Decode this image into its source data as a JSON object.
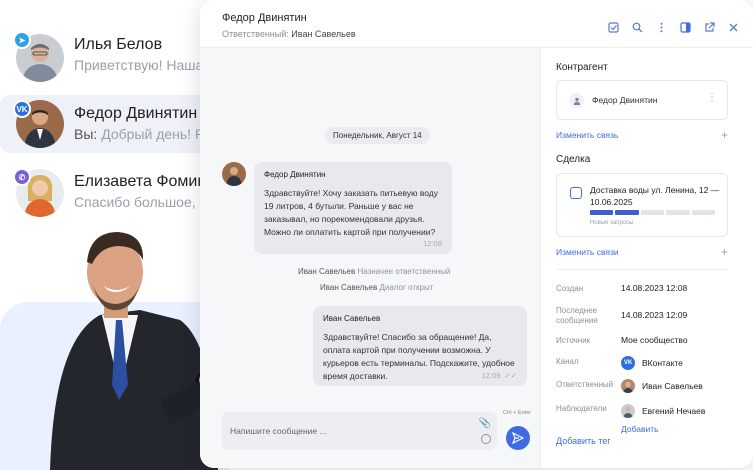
{
  "chat_list": [
    {
      "name": "Илья Белов",
      "you": "",
      "preview": "Приветствую! Наша",
      "channel": "telegram",
      "channel_color": "#2fa3e0",
      "badge_glyph": "➤"
    },
    {
      "name": "Федор Двинятин",
      "you": "Вы:",
      "preview": "Добрый день! Р",
      "channel": "vk",
      "channel_color": "#2e6fe0",
      "badge_glyph": "VK"
    },
    {
      "name": "Елизавета Фомин",
      "you": "",
      "preview": "Спасибо большое, п",
      "channel": "viber",
      "channel_color": "#7b5fd6",
      "badge_glyph": "✆"
    }
  ],
  "header": {
    "title": "Федор Двинятин",
    "subtitle_label": "Ответственный:",
    "subtitle_value": "Иван Савельев",
    "icons": [
      "checkbox-icon",
      "search-icon",
      "more-vertical-icon",
      "panel-icon",
      "external-link-icon",
      "close-icon"
    ]
  },
  "chat": {
    "date": "Понедельник, Август 14",
    "incoming": {
      "author": "Федор Двинятин",
      "text": "Здравствуйте! Хочу заказать питьевую воду 19 литров, 4 бутыли. Раньше у вас не заказывал, но порекомендовали друзья. Можно ли оплатить картой при получении?",
      "time": "12:08"
    },
    "system": [
      {
        "who": "Иван Савельев",
        "action": "Назначен ответственный"
      },
      {
        "who": "Иван Савельев",
        "action": "Диалог открыт"
      }
    ],
    "outgoing": {
      "author": "Иван Савельев",
      "text": "Здравствуйте! Спасибо за обращение! Да, оплата картой при получении возможна. У курьеров есть терминалы. Подскажите, удобное время доставки.",
      "time": "12:09"
    },
    "compose_placeholder": "Напишите сообщение ...",
    "hint": "Ctrl + Enter"
  },
  "panel": {
    "contractor_title": "Контрагент",
    "contractor_name": "Федор Двинятин",
    "change_link_1": "Изменить связь",
    "deal_title": "Сделка",
    "deal_name": "Доставка воды ул. Ленина, 12 — 10.06.2025",
    "deal_stage": "Новые запросы",
    "deal_progress_steps": 5,
    "deal_progress_done": 2,
    "change_link_2": "Изменить связи",
    "rows": {
      "created_label": "Создан",
      "created_value": "14.08.2023 12:08",
      "last_label": "Последнее сообщение",
      "last_value": "14.08.2023 12:09",
      "source_label": "Источник",
      "source_value": "Мое сообщество",
      "channel_label": "Канал",
      "channel_value": "ВКонтакте",
      "responsible_label": "Ответственный",
      "responsible_value": "Иван Савельев",
      "observers_label": "Наблюдатели",
      "observers_value": "Евгений Нечаев",
      "observers_add": "Добавить"
    },
    "add_tag": "Добавить тег"
  },
  "colors": {
    "accent": "#3e6be4",
    "bubble": "#e7e9ee",
    "chat_bg": "#f6f7f9"
  }
}
